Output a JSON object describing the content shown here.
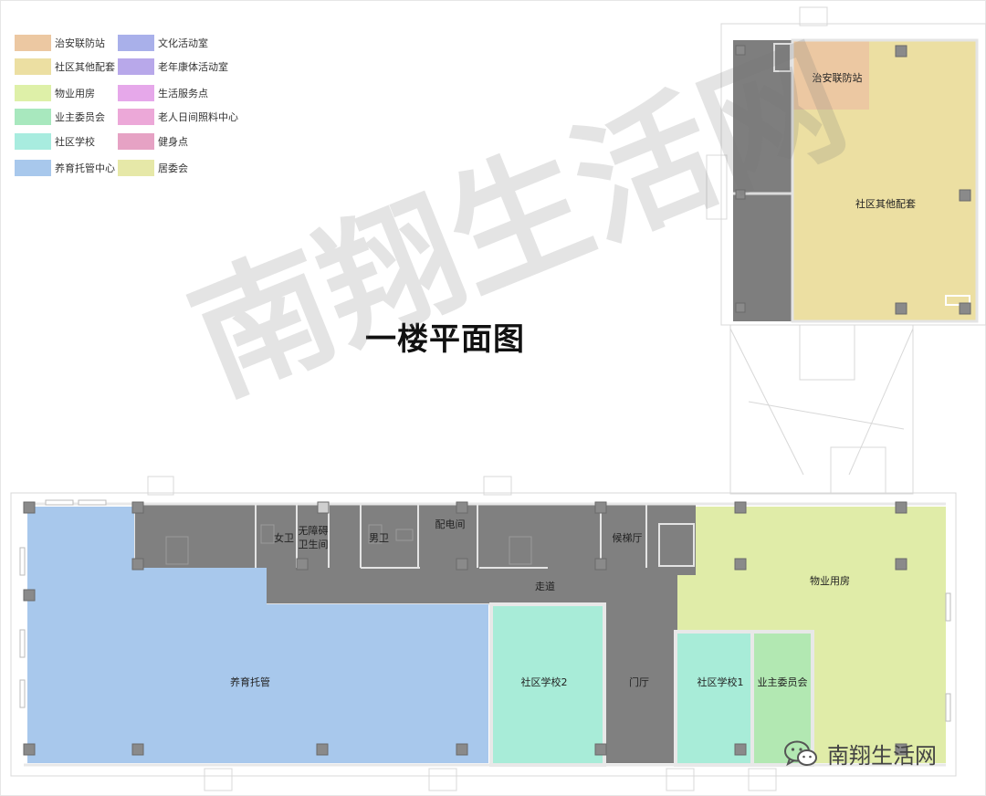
{
  "title": "一楼平面图",
  "watermark": "南翔生活网",
  "brand": {
    "name": "南翔生活网",
    "icon": "wechat-icon"
  },
  "colors": {
    "wall_gray": "#7a7a7a",
    "corridor_gray": "#828282",
    "nursery_blue": "#a8c8ec",
    "school_cyan": "#a8ecd8",
    "owners_green": "#b2e8b2",
    "property_lime": "#e0ecaa",
    "other_khaki": "#ecdfa2",
    "police_orange": "#ecc8a2",
    "outline": "#d0d0d0"
  },
  "legend": [
    {
      "label": "治安联防站",
      "color": "#ecc8a2"
    },
    {
      "label": "文化活动室",
      "color": "#a9b0ea"
    },
    {
      "label": "社区其他配套",
      "color": "#ecdfa2"
    },
    {
      "label": "老年康体活动室",
      "color": "#b8a8ea"
    },
    {
      "label": "物业用房",
      "color": "#def0a8"
    },
    {
      "label": "生活服务点",
      "color": "#e6a8ea"
    },
    {
      "label": "业主委员会",
      "color": "#a8e8be"
    },
    {
      "label": "老人日间照料中心",
      "color": "#eca8d8"
    },
    {
      "label": "社区学校",
      "color": "#a8ecdf"
    },
    {
      "label": "健身点",
      "color": "#e6a2c4"
    },
    {
      "label": "养育托管中心",
      "color": "#a8c8ec"
    },
    {
      "label": "居委会",
      "color": "#e6e8a8"
    }
  ],
  "rooms": {
    "police": "治安联防站",
    "other": "社区其他配套",
    "female_wc": "女卫",
    "accessible_wc_line1": "无障碍",
    "accessible_wc_line2": "卫生间",
    "male_wc": "男卫",
    "electrical": "配电间",
    "elevator_hall": "候梯厅",
    "corridor": "走道",
    "property": "物业用房",
    "nursery": "养育托管",
    "school2": "社区学校2",
    "lobby": "门厅",
    "school1": "社区学校1",
    "owners": "业主委员会"
  }
}
